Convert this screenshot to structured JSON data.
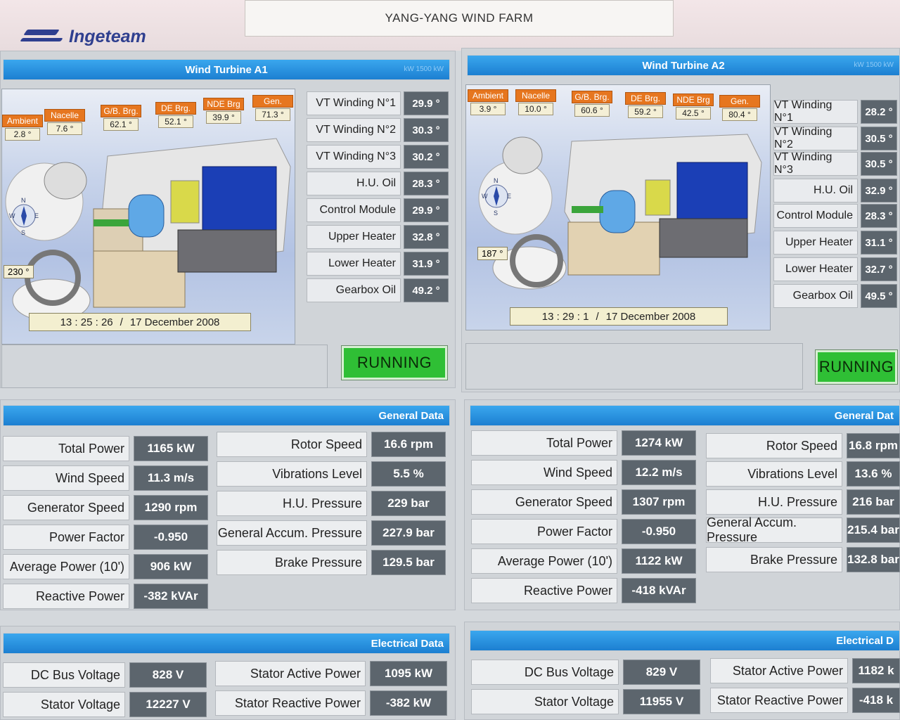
{
  "header": {
    "title": "YANG-YANG WIND FARM",
    "logo_text": "Ingeteam"
  },
  "turbines": [
    {
      "title": "Wind Turbine A1",
      "rating": "kW 1500 kW",
      "temps": [
        {
          "name": "Ambient",
          "value": "2.8 °"
        },
        {
          "name": "Nacelle",
          "value": "7.6 °"
        },
        {
          "name": "G/B. Brg.",
          "value": "62.1 °"
        },
        {
          "name": "DE Brg.",
          "value": "52.1 °"
        },
        {
          "name": "NDE Brg",
          "value": "39.9 °"
        },
        {
          "name": "Gen.",
          "value": "71.3 °"
        }
      ],
      "bearing": "230 °",
      "time": "13 : 25 : 26",
      "date_sep": "/",
      "date": "17  December  2008",
      "windings": [
        {
          "label": "VT Winding N°1",
          "value": "29.9 °"
        },
        {
          "label": "VT Winding N°2",
          "value": "30.3 °"
        },
        {
          "label": "VT Winding N°3",
          "value": "30.2 °"
        },
        {
          "label": "H.U. Oil",
          "value": "28.3 °"
        },
        {
          "label": "Control Module",
          "value": "29.9 °"
        },
        {
          "label": "Upper Heater",
          "value": "32.8 °"
        },
        {
          "label": "Lower Heater",
          "value": "31.9 °"
        },
        {
          "label": "Gearbox Oil",
          "value": "49.2 °"
        }
      ],
      "status": "RUNNING",
      "general_title": "General Data",
      "general_left": [
        {
          "label": "Total Power",
          "value": "1165 kW"
        },
        {
          "label": "Wind Speed",
          "value": "11.3 m/s"
        },
        {
          "label": "Generator Speed",
          "value": "1290 rpm"
        },
        {
          "label": "Power Factor",
          "value": "-0.950"
        },
        {
          "label": "Average Power (10')",
          "value": "906 kW"
        },
        {
          "label": "Reactive Power",
          "value": "-382 kVAr"
        }
      ],
      "general_right": [
        {
          "label": "Rotor Speed",
          "value": "16.6 rpm"
        },
        {
          "label": "Vibrations Level",
          "value": "5.5 %"
        },
        {
          "label": "H.U. Pressure",
          "value": "229 bar"
        },
        {
          "label": "General Accum. Pressure",
          "value": "227.9 bar"
        },
        {
          "label": "Brake Pressure",
          "value": "129.5 bar"
        }
      ],
      "electrical_title": "Electrical Data",
      "electrical_left": [
        {
          "label": "DC Bus Voltage",
          "value": "828 V"
        },
        {
          "label": "Stator Voltage",
          "value": "12227 V"
        }
      ],
      "electrical_right": [
        {
          "label": "Stator Active Power",
          "value": "1095 kW"
        },
        {
          "label": "Stator Reactive Power",
          "value": "-382 kW"
        }
      ]
    },
    {
      "title": "Wind Turbine A2",
      "rating": "kW 1500 kW",
      "temps": [
        {
          "name": "Ambient",
          "value": "3.9 °"
        },
        {
          "name": "Nacelle",
          "value": "10.0 °"
        },
        {
          "name": "G/B. Brg.",
          "value": "60.6 °"
        },
        {
          "name": "DE Brg.",
          "value": "59.2 °"
        },
        {
          "name": "NDE Brg",
          "value": "42.5 °"
        },
        {
          "name": "Gen.",
          "value": "80.4 °"
        }
      ],
      "bearing": "187 °",
      "time": "13 : 29 : 1",
      "date_sep": "/",
      "date": "17  December  2008",
      "windings": [
        {
          "label": "VT Winding N°1",
          "value": "28.2 °"
        },
        {
          "label": "VT Winding N°2",
          "value": "30.5 °"
        },
        {
          "label": "VT Winding N°3",
          "value": "30.5 °"
        },
        {
          "label": "H.U. Oil",
          "value": "32.9 °"
        },
        {
          "label": "Control Module",
          "value": "28.3 °"
        },
        {
          "label": "Upper Heater",
          "value": "31.1 °"
        },
        {
          "label": "Lower Heater",
          "value": "32.7 °"
        },
        {
          "label": "Gearbox Oil",
          "value": "49.5 °"
        }
      ],
      "status": "RUNNING",
      "general_title": "General Dat",
      "general_left": [
        {
          "label": "Total Power",
          "value": "1274 kW"
        },
        {
          "label": "Wind Speed",
          "value": "12.2 m/s"
        },
        {
          "label": "Generator Speed",
          "value": "1307 rpm"
        },
        {
          "label": "Power Factor",
          "value": "-0.950"
        },
        {
          "label": "Average Power (10')",
          "value": "1122 kW"
        },
        {
          "label": "Reactive Power",
          "value": "-418 kVAr"
        }
      ],
      "general_right": [
        {
          "label": "Rotor Speed",
          "value": "16.8 rpm"
        },
        {
          "label": "Vibrations Level",
          "value": "13.6 %"
        },
        {
          "label": "H.U. Pressure",
          "value": "216 bar"
        },
        {
          "label": "General Accum. Pressure",
          "value": "215.4 bar"
        },
        {
          "label": "Brake Pressure",
          "value": "132.8 bar"
        }
      ],
      "electrical_title": "Electrical D",
      "electrical_left": [
        {
          "label": "DC Bus Voltage",
          "value": "829 V"
        },
        {
          "label": "Stator Voltage",
          "value": "11955 V"
        }
      ],
      "electrical_right": [
        {
          "label": "Stator Active Power",
          "value": "1182 k"
        },
        {
          "label": "Stator Reactive Power",
          "value": "-418 k"
        }
      ]
    }
  ],
  "compass_letters": {
    "n": "N",
    "s": "S",
    "e": "E",
    "w": "W"
  },
  "colors": {
    "header_blue": "#1c7fd1",
    "running_green": "#2fbf35",
    "temp_orange": "#e6761f",
    "value_gray": "#5c656d"
  }
}
